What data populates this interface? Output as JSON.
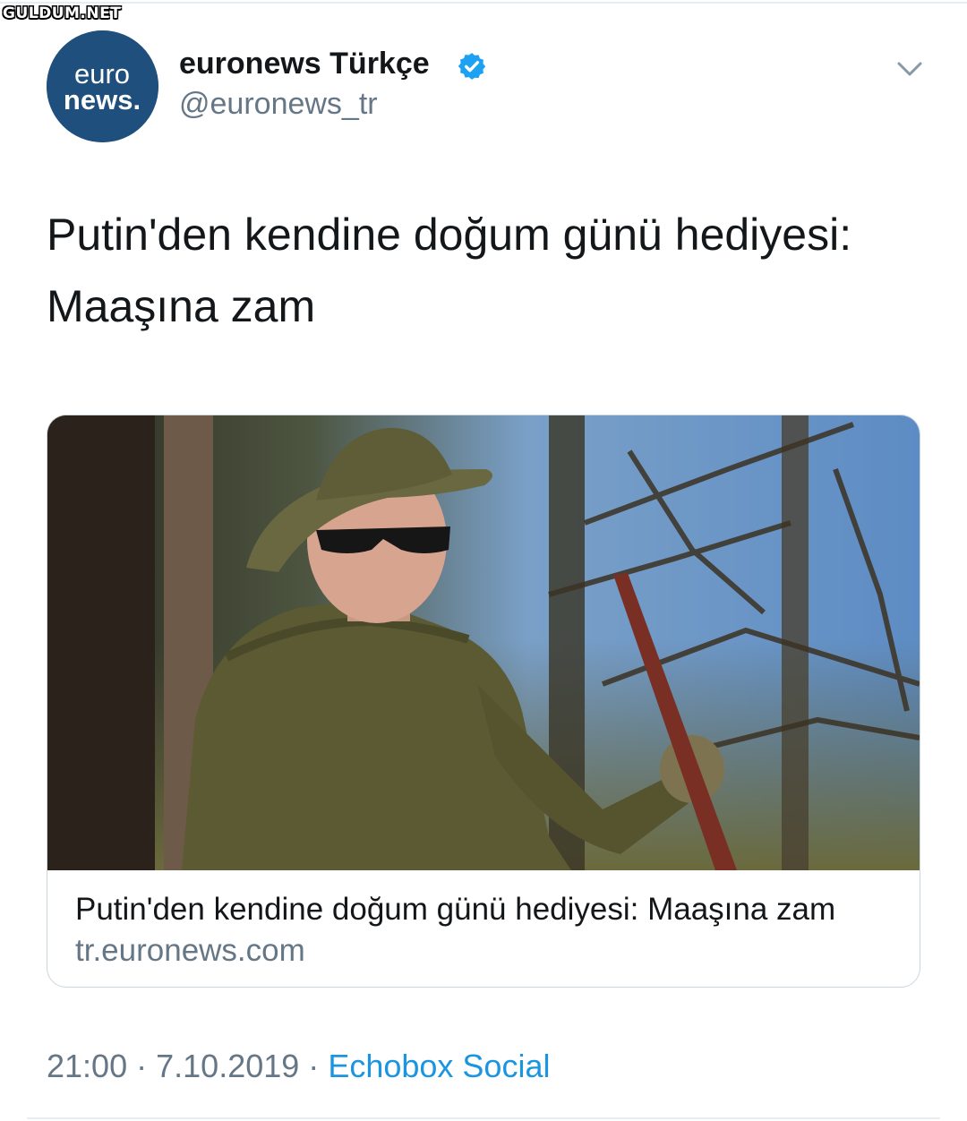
{
  "watermark": "GULDUM.NET",
  "account": {
    "display_name": "euronews Türkçe",
    "handle": "@euronews_tr",
    "avatar_text_top": "euro",
    "avatar_text_bottom": "news.",
    "verified": true
  },
  "tweet": {
    "text_lines": [
      "Putin'den kendine doğum günü hediyesi:",
      "Maaşına zam"
    ]
  },
  "card": {
    "title": "Putin'den kendine doğum günü hediyesi: Maaşına zam",
    "domain": "tr.euronews.com"
  },
  "meta": {
    "time": "21:00",
    "date": "7.10.2019",
    "separator": "·",
    "source": "Echobox Social"
  },
  "icons": {
    "verified": "verified-badge-icon",
    "caret": "chevron-down-icon"
  },
  "colors": {
    "text": "#14171a",
    "secondary": "#657786",
    "link": "#1b95e0",
    "verified": "#1da1f2",
    "avatar_bg": "#1e4f7d"
  }
}
